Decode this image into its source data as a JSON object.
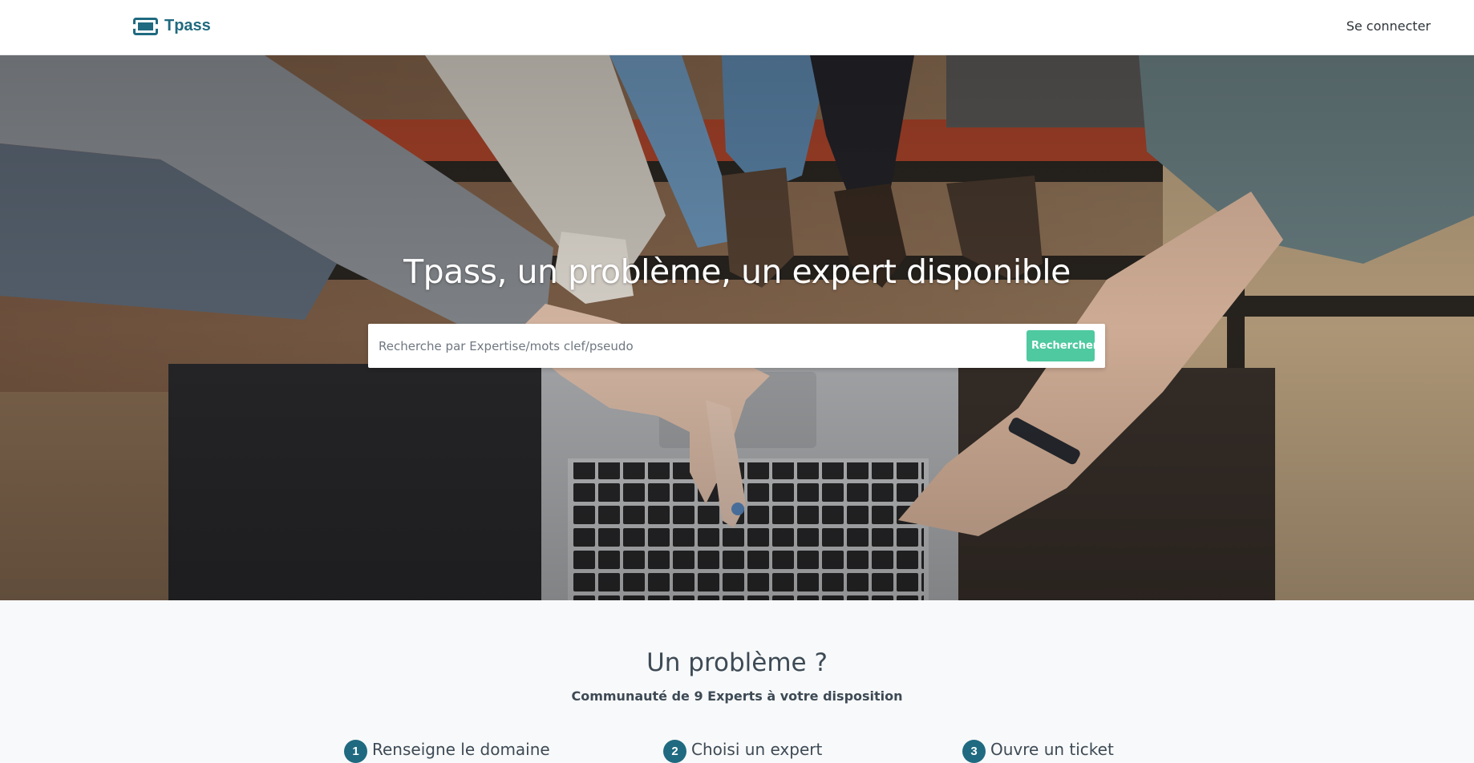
{
  "navbar": {
    "brand": "Tpass",
    "brand_icon": "ticket-icon",
    "login_label": "Se connecter"
  },
  "hero": {
    "title": "Tpass, un problème, un expert disponible",
    "background": "photo of people around a laptop",
    "search": {
      "placeholder": "Recherche par Expertise/mots clef/pseudo",
      "value": "",
      "button_label": "Rechercher"
    }
  },
  "section": {
    "title": "Un problème ?",
    "subtitle": "Communauté de 9 Experts à votre disposition",
    "steps": [
      {
        "number": "1",
        "label": "Renseigne le domaine"
      },
      {
        "number": "2",
        "label": "Choisi un expert"
      },
      {
        "number": "3",
        "label": "Ouvre un ticket"
      }
    ]
  },
  "colors": {
    "brand": "#1f6a80",
    "accent_button": "#4ec9a0",
    "section_background": "#f8f9fa"
  }
}
